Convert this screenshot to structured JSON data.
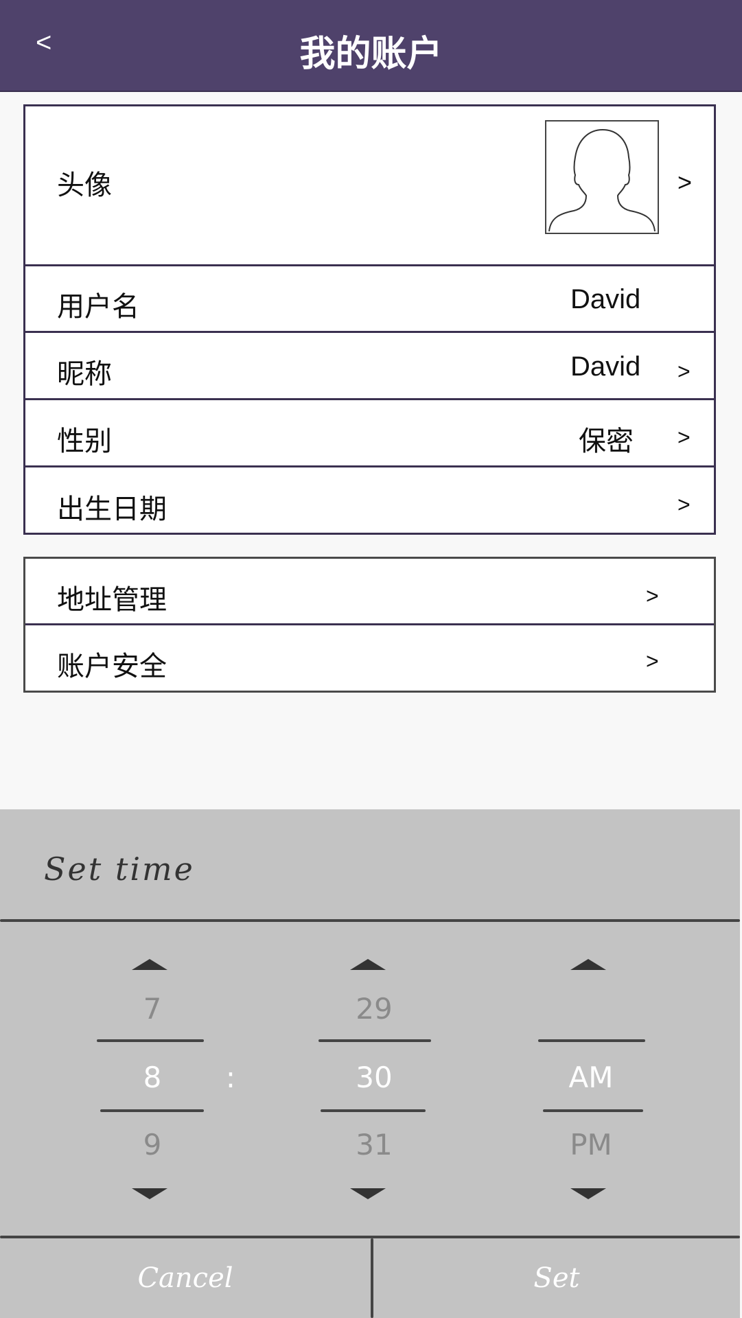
{
  "header": {
    "back_label": "<",
    "title": "我的账户"
  },
  "profile": {
    "avatar_label": "头像",
    "avatar_chevron": ">",
    "username_label": "用户名",
    "username_value": "David",
    "nickname_label": "昵称",
    "nickname_value": "David",
    "nickname_chevron": ">",
    "gender_label": "性别",
    "gender_value": "保密",
    "gender_chevron": ">",
    "birthday_label": "出生日期",
    "birthday_chevron": ">"
  },
  "settings": {
    "address_label": "地址管理",
    "address_chevron": ">",
    "security_label": "账户安全",
    "security_chevron": ">"
  },
  "time_picker": {
    "title": "Set time",
    "hour_prev": "7",
    "hour_selected": "8",
    "hour_next": "9",
    "separator": ":",
    "minute_prev": "29",
    "minute_selected": "30",
    "minute_next": "31",
    "ampm_selected": "AM",
    "ampm_next": "PM",
    "cancel_label": "Cancel",
    "set_label": "Set"
  }
}
